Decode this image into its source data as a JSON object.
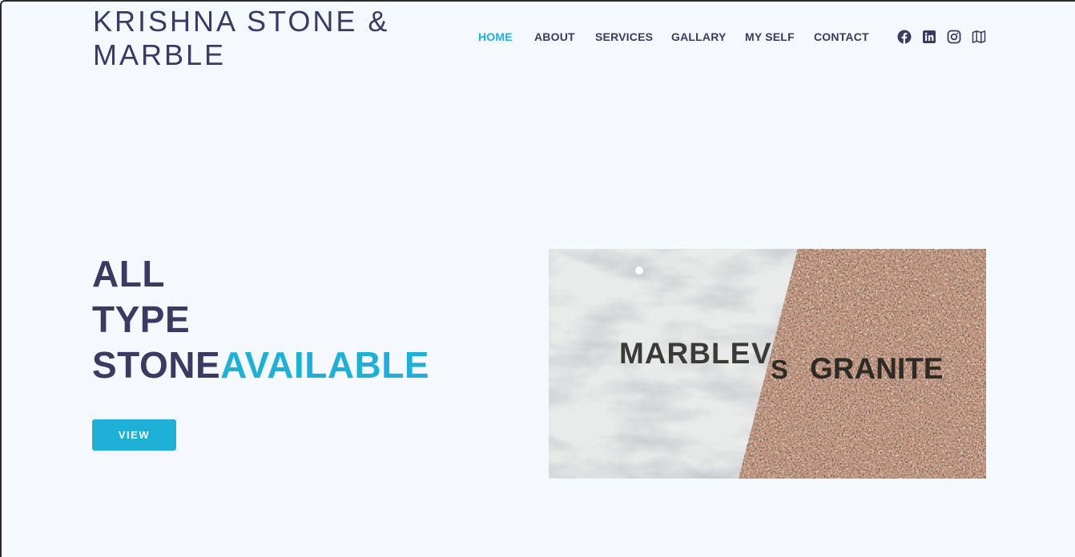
{
  "brand": {
    "name": "KRISHNA STONE & MARBLE"
  },
  "nav": {
    "items": [
      {
        "label": "HOME",
        "active": true
      },
      {
        "label": "ABOUT",
        "active": false
      },
      {
        "label": "SERVICES",
        "active": false
      },
      {
        "label": "GALLARY",
        "active": false
      },
      {
        "label": "MY SELF",
        "active": false
      },
      {
        "label": "CONTACT",
        "active": false
      }
    ]
  },
  "social": [
    "facebook-icon",
    "linkedin-icon",
    "instagram-icon",
    "map-icon"
  ],
  "hero": {
    "line1": "ALL",
    "line2": "TYPE",
    "line3_a": "STONE",
    "line3_b": "AVAILABLE",
    "button_label": "VIEW",
    "image_text": {
      "left": "MARBLE",
      "vs_v": "V",
      "vs_s": "S",
      "right": "GRANITE"
    }
  },
  "colors": {
    "primary": "#3c3a62",
    "accent": "#1fb0d8",
    "background": "#f5f8fd"
  }
}
